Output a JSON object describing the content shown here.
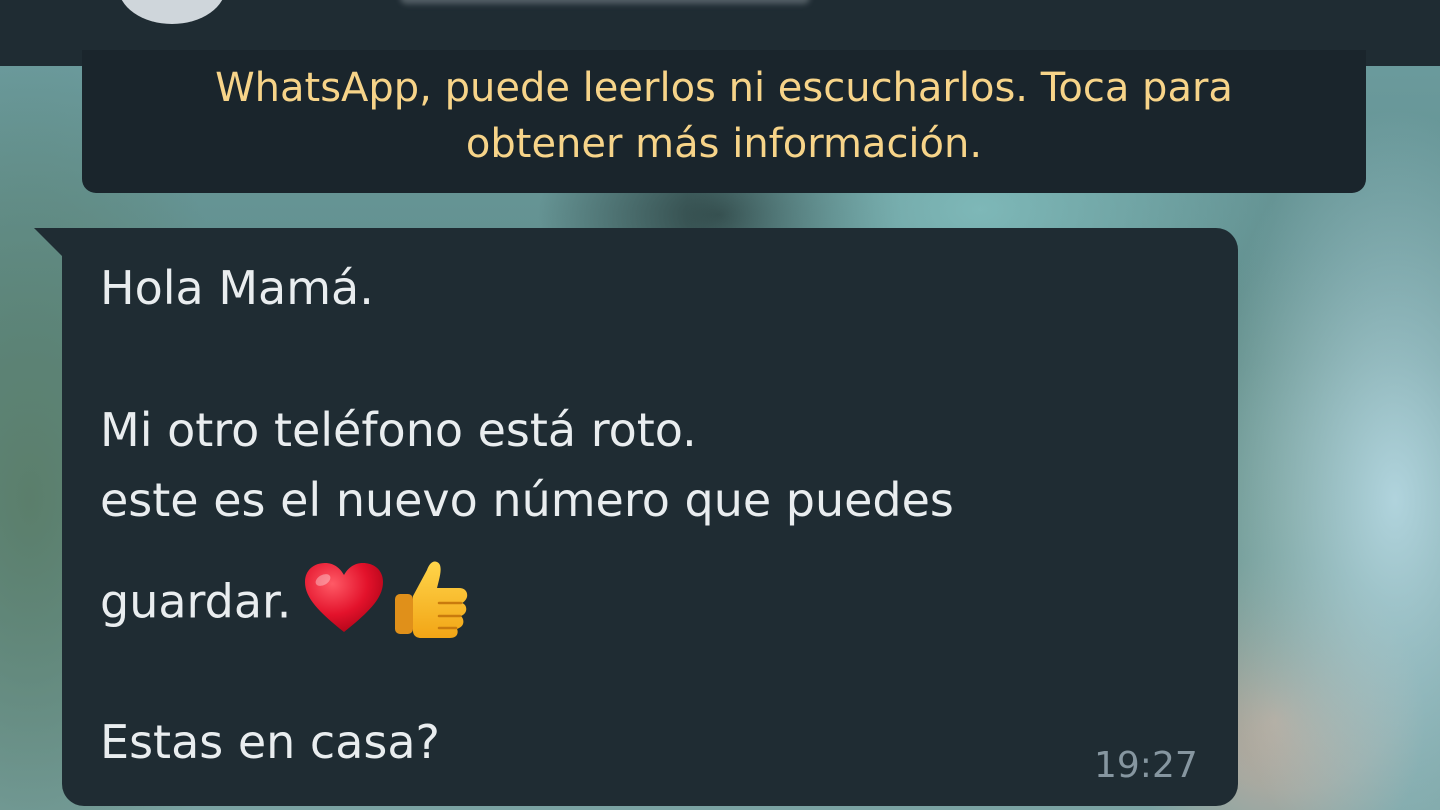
{
  "encryption_notice": {
    "line1": "WhatsApp, puede leerlos ni escucharlos. Toca para",
    "line2": "obtener más información."
  },
  "message": {
    "greeting": "Hola Mamá.",
    "line2": "Mi otro teléfono está roto.",
    "line3": "este es el nuevo número que puedes",
    "line4": "guardar.",
    "line4_emoji": [
      "red-heart",
      "thumbs-up"
    ],
    "line5": "Estas en casa?",
    "time": "19:27"
  },
  "colors": {
    "bubble": "#1f2c33",
    "message_text": "#e9edef",
    "notice_text": "#f7d489",
    "timestamp": "#8696a0"
  }
}
